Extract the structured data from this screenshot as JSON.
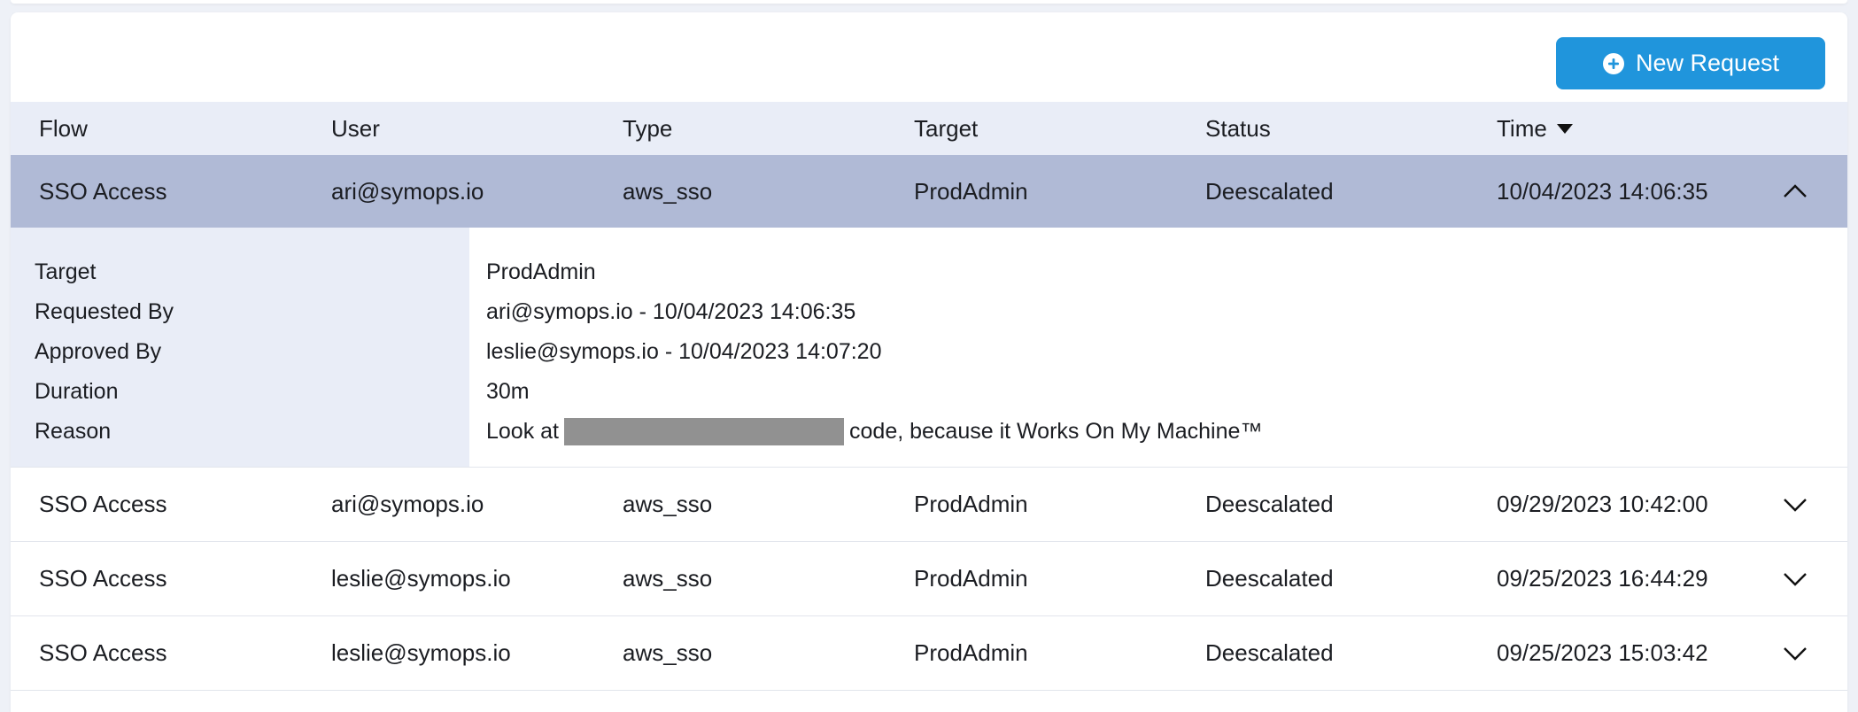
{
  "toolbar": {
    "new_request_label": "New Request",
    "accent_color": "#2095dc"
  },
  "table": {
    "columns": [
      "Flow",
      "User",
      "Type",
      "Target",
      "Status",
      "Time"
    ],
    "sort_column": "Time",
    "sort_direction": "descending",
    "rows": [
      {
        "flow": "SSO Access",
        "user": "ari@symops.io",
        "type": "aws_sso",
        "target": "ProdAdmin",
        "status": "Deescalated",
        "time": "10/04/2023 14:06:35",
        "expanded": true
      },
      {
        "flow": "SSO Access",
        "user": "ari@symops.io",
        "type": "aws_sso",
        "target": "ProdAdmin",
        "status": "Deescalated",
        "time": "09/29/2023 10:42:00",
        "expanded": false
      },
      {
        "flow": "SSO Access",
        "user": "leslie@symops.io",
        "type": "aws_sso",
        "target": "ProdAdmin",
        "status": "Deescalated",
        "time": "09/25/2023 16:44:29",
        "expanded": false
      },
      {
        "flow": "SSO Access",
        "user": "leslie@symops.io",
        "type": "aws_sso",
        "target": "ProdAdmin",
        "status": "Deescalated",
        "time": "09/25/2023 15:03:42",
        "expanded": false
      }
    ]
  },
  "details": {
    "labels": {
      "target": "Target",
      "requested_by": "Requested By",
      "approved_by": "Approved By",
      "duration": "Duration",
      "reason": "Reason"
    },
    "values": {
      "target": "ProdAdmin",
      "requested_by": "ari@symops.io - 10/04/2023 14:06:35",
      "approved_by": "leslie@symops.io - 10/04/2023 14:07:20",
      "duration": "30m",
      "reason_before": "Look at",
      "reason_after": "code, because it Works On My Machine™"
    }
  },
  "colors": {
    "header_bg": "#e9edf7",
    "selected_row_bg": "#b0bad6",
    "redaction": "#919191"
  }
}
